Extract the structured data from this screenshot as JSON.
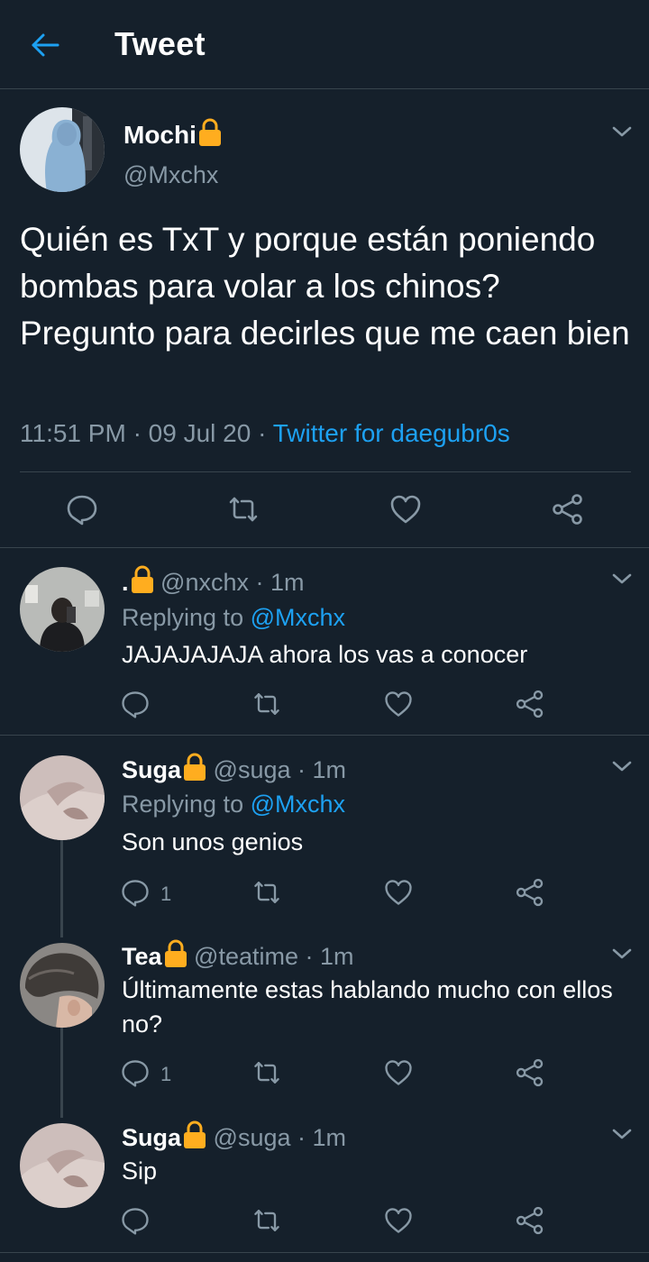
{
  "header": {
    "title": "Tweet",
    "back_icon": "arrow-left-icon",
    "accent": "#1da1f2"
  },
  "main_tweet": {
    "name": "Mochi",
    "handle": "@Mxchx",
    "text": "Quién es TxT y porque están poniendo bombas para volar a los chinos? Pregunto para decirles que me caen bien",
    "time": "11:51 PM",
    "date": "09 Jul 20",
    "source": "Twitter for daegubr0s",
    "actions": [
      "reply-icon",
      "retweet-icon",
      "like-icon",
      "share-icon"
    ]
  },
  "replies": [
    {
      "name": ".",
      "handle": "@nxchx",
      "time": "1m",
      "replying_label": "Replying to",
      "replying_to": "@Mxchx",
      "text": "JAJAJAJAJA ahora los vas a conocer",
      "reply_count": ""
    },
    {
      "name": "Suga",
      "handle": "@suga",
      "time": "1m",
      "replying_label": "Replying to",
      "replying_to": "@Mxchx",
      "text": "Son unos genios",
      "reply_count": "1"
    },
    {
      "name": "Tea",
      "handle": "@teatime",
      "time": "1m",
      "text": "Últimamente estas hablando mucho con ellos no?",
      "reply_count": "1"
    },
    {
      "name": "Suga",
      "handle": "@suga",
      "time": "1m",
      "text": "Sip",
      "reply_count": ""
    }
  ],
  "separator": "·",
  "colors": {
    "background": "#15202b",
    "border": "#38444d",
    "muted": "#8899a6",
    "link": "#1da1f2",
    "lock": "#ffad1f"
  }
}
